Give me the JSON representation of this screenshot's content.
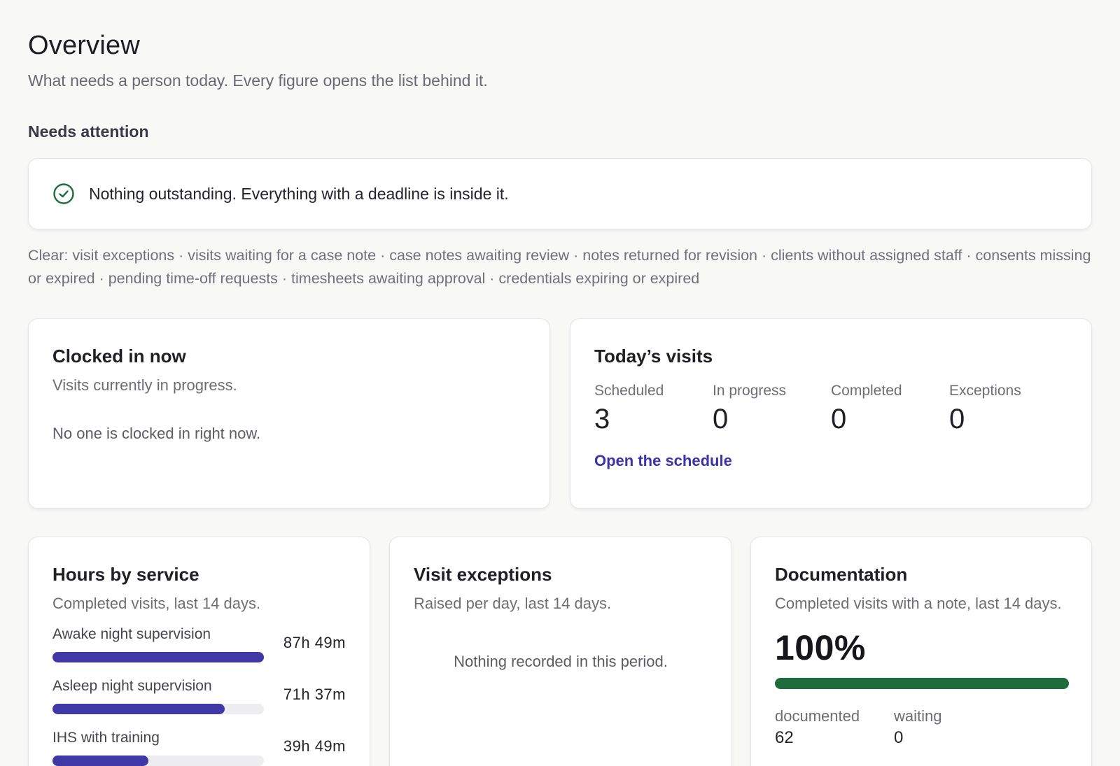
{
  "header": {
    "title": "Overview",
    "subtitle": "What needs a person today. Every figure opens the list behind it."
  },
  "attention": {
    "section_title": "Needs attention",
    "message": "Nothing outstanding. Everything with a deadline is inside it.",
    "icon": "check-circle-icon",
    "clear_list": "Clear: visit exceptions · visits waiting for a case note · case notes awaiting review · notes returned for revision · clients without assigned staff · consents missing or expired · pending time-off requests · timesheets awaiting approval · credentials expiring or expired"
  },
  "clocked_in": {
    "title": "Clocked in now",
    "description": "Visits currently in progress.",
    "empty_text": "No one is clocked in right now."
  },
  "todays_visits": {
    "title": "Today’s visits",
    "stats": [
      {
        "label": "Scheduled",
        "value": "3"
      },
      {
        "label": "In progress",
        "value": "0"
      },
      {
        "label": "Completed",
        "value": "0"
      },
      {
        "label": "Exceptions",
        "value": "0"
      }
    ],
    "link_label": "Open the schedule"
  },
  "hours_by_service": {
    "title": "Hours by service",
    "description": "Completed visits, last 14 days.",
    "services": [
      {
        "name": "Awake night supervision",
        "duration": "87h 49m",
        "fraction": 1.0
      },
      {
        "name": "Asleep night supervision",
        "duration": "71h 37m",
        "fraction": 0.815
      },
      {
        "name": "IHS with training",
        "duration": "39h 49m",
        "fraction": 0.453
      }
    ]
  },
  "visit_exceptions": {
    "title": "Visit exceptions",
    "description": "Raised per day, last 14 days.",
    "empty_text": "Nothing recorded in this period."
  },
  "documentation": {
    "title": "Documentation",
    "description": "Completed visits with a note, last 14 days.",
    "percent_label": "100%",
    "fraction": 1.0,
    "counts": [
      {
        "label": "documented",
        "value": "62"
      },
      {
        "label": "waiting",
        "value": "0"
      }
    ]
  },
  "colors": {
    "accent": "#4138a8",
    "link": "#3b33a6",
    "success": "#1e6b3c",
    "check": "#1e6b3c"
  }
}
